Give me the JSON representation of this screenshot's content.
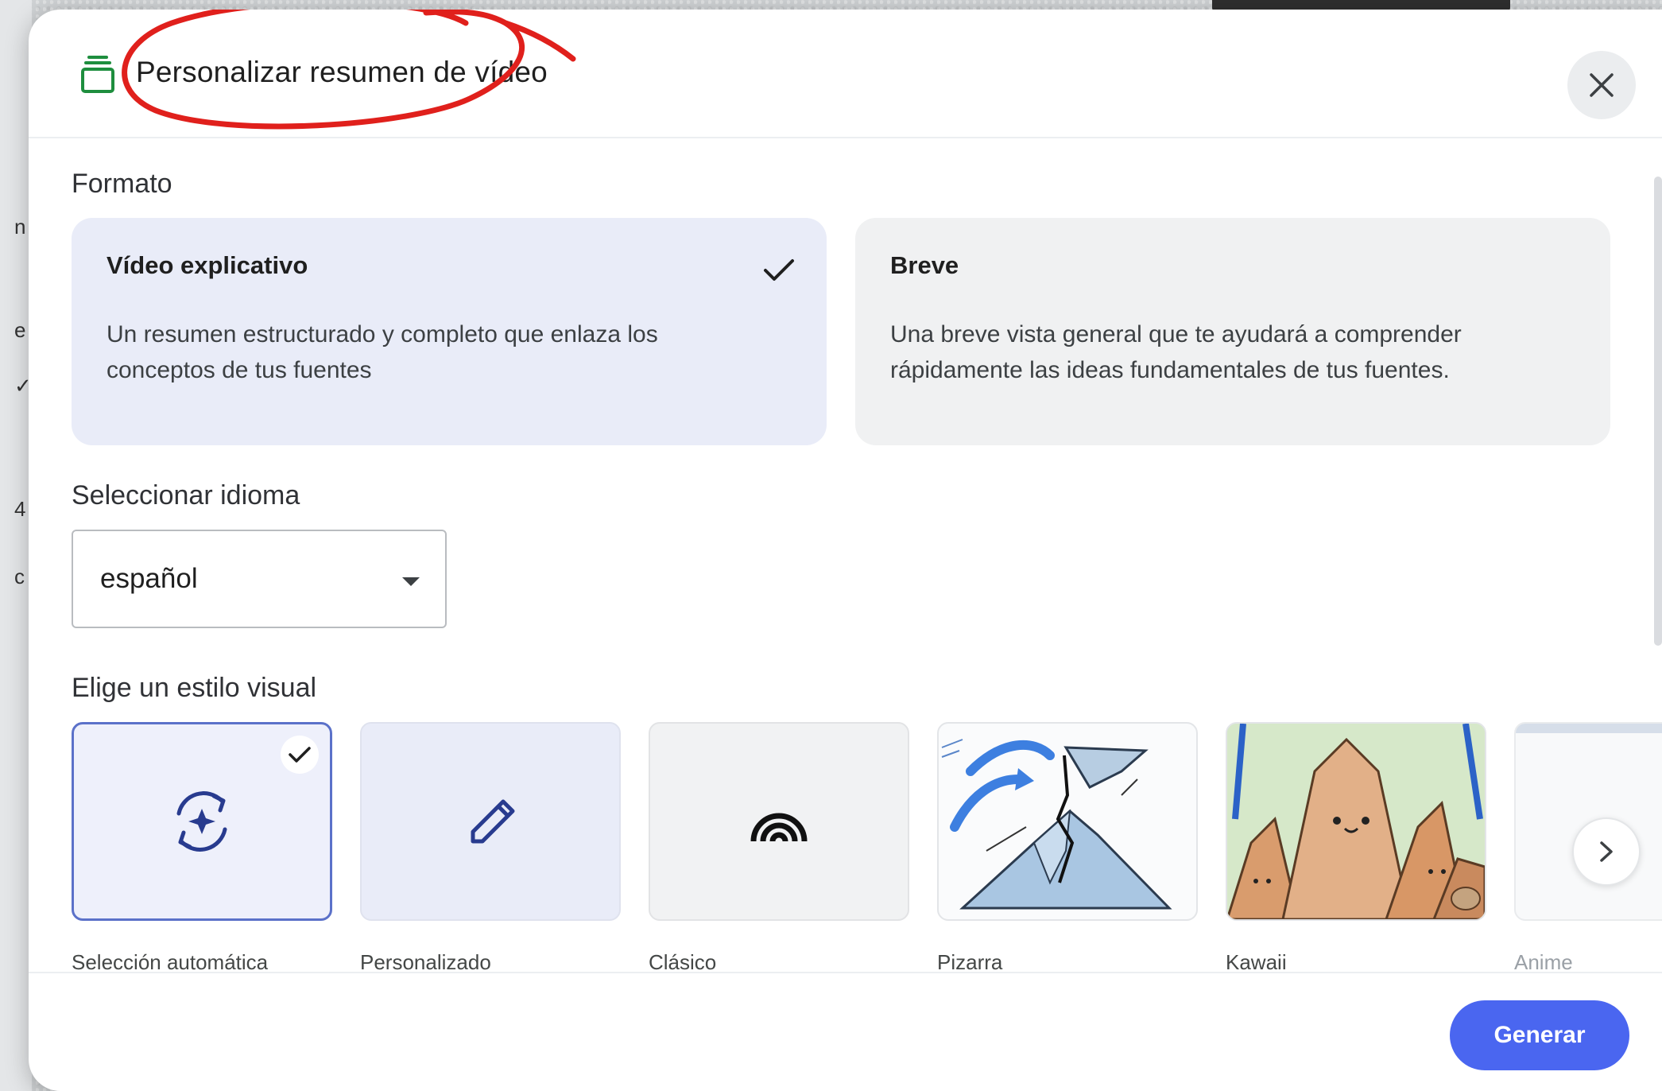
{
  "dialog": {
    "title": "Personalizar resumen de vídeo",
    "title_icon": "stacked-layers-icon",
    "close_icon": "close-icon"
  },
  "format": {
    "label": "Formato",
    "options": [
      {
        "title": "Vídeo explicativo",
        "description_line1": "Un resumen estructurado y completo que enlaza los",
        "description_line2": "conceptos de tus fuentes",
        "selected": true
      },
      {
        "title": "Breve",
        "description_line1": "Una breve vista general que te ayudará a comprender",
        "description_line2": "rápidamente las ideas fundamentales de tus fuentes.",
        "selected": false
      }
    ]
  },
  "language": {
    "label": "Seleccionar idioma",
    "value": "español"
  },
  "visual_style": {
    "label": "Elige un estilo visual",
    "options": [
      {
        "label": "Selección automática",
        "icon": "auto-sparkle-refresh-icon",
        "selected": true
      },
      {
        "label": "Personalizado",
        "icon": "pencil-icon",
        "selected": false
      },
      {
        "label": "Clásico",
        "icon": "rainbow-arcs-icon",
        "selected": false
      },
      {
        "label": "Pizarra",
        "icon": "volcano-sketch-thumbnail",
        "selected": false
      },
      {
        "label": "Kawaii",
        "icon": "kawaii-mountains-thumbnail",
        "selected": false
      },
      {
        "label": "Anime",
        "icon": "anime-thumbnail",
        "selected": false
      }
    ],
    "next_icon": "chevron-right-icon"
  },
  "footer": {
    "generate_label": "Generar"
  },
  "colors": {
    "primary": "#4a66f0",
    "selected_card": "#e9ecf8",
    "annotation": "#e0201c"
  }
}
